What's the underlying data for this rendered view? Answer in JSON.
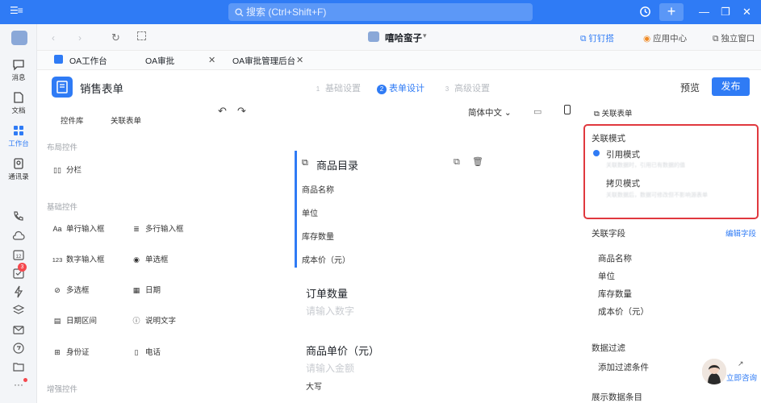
{
  "titlebar": {
    "search_placeholder": "搜索 (Ctrl+Shift+F)",
    "plus": "+",
    "history_icon": "clock-history-icon",
    "minimize": "—",
    "restore": "❐",
    "close": "✕"
  },
  "header": {
    "org_name": "嘻哈蛮子",
    "dingpin": "钉钉搭",
    "app_center": "应用中心",
    "standalone": "独立窗口"
  },
  "leftnav": {
    "items": [
      {
        "label": "消息",
        "icon": "chat-bubble-icon"
      },
      {
        "label": "文档",
        "icon": "document-icon"
      },
      {
        "label": "工作台",
        "icon": "grid-icon"
      },
      {
        "label": "通讯录",
        "icon": "contacts-icon"
      }
    ],
    "badge": "3"
  },
  "tabs": [
    {
      "label": "OA工作台"
    },
    {
      "label": "OA审批"
    },
    {
      "label": "OA审批管理后台"
    }
  ],
  "form": {
    "title": "销售表单",
    "steps": [
      {
        "num": "1",
        "label": "基础设置"
      },
      {
        "num": "2",
        "label": "表单设计"
      },
      {
        "num": "3",
        "label": "高级设置"
      }
    ],
    "preview": "预览",
    "publish": "发布"
  },
  "leftpanel": {
    "tab_controls": "控件库",
    "tab_linked": "关联表单",
    "cat_layout": "布局控件",
    "layout_controls": [
      {
        "label": "分栏",
        "icon": "columns-icon"
      }
    ],
    "cat_basic": "基础控件",
    "basic_controls": [
      {
        "label": "单行输入框",
        "icon": "Aa"
      },
      {
        "label": "多行输入框",
        "icon": "multiline-icon"
      },
      {
        "label": "数字输入框",
        "icon": "123"
      },
      {
        "label": "单选框",
        "icon": "radio-icon"
      },
      {
        "label": "多选框",
        "icon": "checkbox-icon"
      },
      {
        "label": "日期",
        "icon": "calendar-icon"
      },
      {
        "label": "日期区间",
        "icon": "date-range-icon"
      },
      {
        "label": "说明文字",
        "icon": "info-icon"
      },
      {
        "label": "身份证",
        "icon": "id-card-icon"
      },
      {
        "label": "电话",
        "icon": "phone-icon"
      }
    ],
    "cat_enhanced": "增强控件"
  },
  "canvas": {
    "lang": "简体中文",
    "catalog_title": "商品目录",
    "catalog_fields": [
      "商品名称",
      "单位",
      "库存数量",
      "成本价（元）"
    ],
    "qty_label": "订单数量",
    "qty_placeholder": "请输入数字",
    "price_label": "商品单价（元）",
    "price_placeholder": "请输入金额",
    "daxie": "大写"
  },
  "rightpanel": {
    "type_label": "关联表单",
    "mode_title": "关联模式",
    "mode_ref": "引用模式",
    "mode_ref_desc": "关联数据时，引用已有数据的值",
    "mode_copy": "拷贝模式",
    "mode_copy_desc": "关联数据后，数据可修改但不影响源表单",
    "fields_title": "关联字段",
    "edit_fields": "编辑字段",
    "fields": [
      "商品名称",
      "单位",
      "库存数量",
      "成本价（元）"
    ],
    "filter_title": "数据过滤",
    "add_filter": "添加过滤条件",
    "show_entries": "展示数据条目"
  },
  "consult": "立即咨询"
}
